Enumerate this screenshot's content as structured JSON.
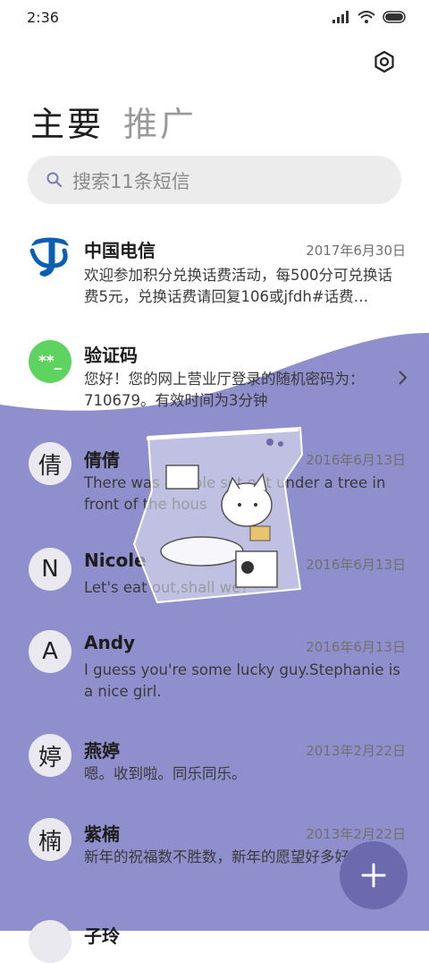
{
  "status_bar": {
    "time": "2:36"
  },
  "tabs": [
    {
      "label": "主要",
      "active": true
    },
    {
      "label": "推广",
      "active": false
    }
  ],
  "search": {
    "placeholder": "搜索11条短信"
  },
  "messages": [
    {
      "sender": "中国电信",
      "date": "2017年6月30日",
      "preview": "欢迎参加积分兑换话费活动，每500分可兑换话费5元，兑换话费请回复106或jfdh#话费…",
      "avatar": "telecom-logo"
    },
    {
      "sender": "验证码",
      "date": "",
      "preview": "您好！您的网上营业厅登录的随机密码为：710679。有效时间为3分钟",
      "avatar": "code-badge",
      "avatar_text": "**_"
    },
    {
      "sender": "倩倩",
      "date": "2016年6月13日",
      "preview": "There was a table set out under a tree in front of the hous",
      "avatar_text": "倩"
    },
    {
      "sender": "Nicole",
      "date": "2016年6月13日",
      "preview": "Let's eat out,shall we?",
      "avatar_text": "N"
    },
    {
      "sender": "Andy",
      "date": "2016年6月13日",
      "preview": "I guess you're some lucky guy.Stephanie is a nice girl.",
      "avatar_text": "A"
    },
    {
      "sender": "燕婷",
      "date": "2013年2月22日",
      "preview": "嗯。收到啦。同乐同乐。",
      "avatar_text": "婷"
    },
    {
      "sender": "紫楠",
      "date": "2013年2月22日",
      "preview": "新年的祝福数不胜数，新年的愿望好多好多，新年的问候依旧美好，在这个温馨的日子里",
      "avatar_text": "楠"
    },
    {
      "sender": "子玲",
      "date": "",
      "preview": "",
      "avatar_text": ""
    }
  ],
  "colors": {
    "wallpaper": "#8e8fcc",
    "fab": "#6c6aae",
    "code_badge": "#5fd35f",
    "telecom_blue": "#0a5fb3"
  }
}
